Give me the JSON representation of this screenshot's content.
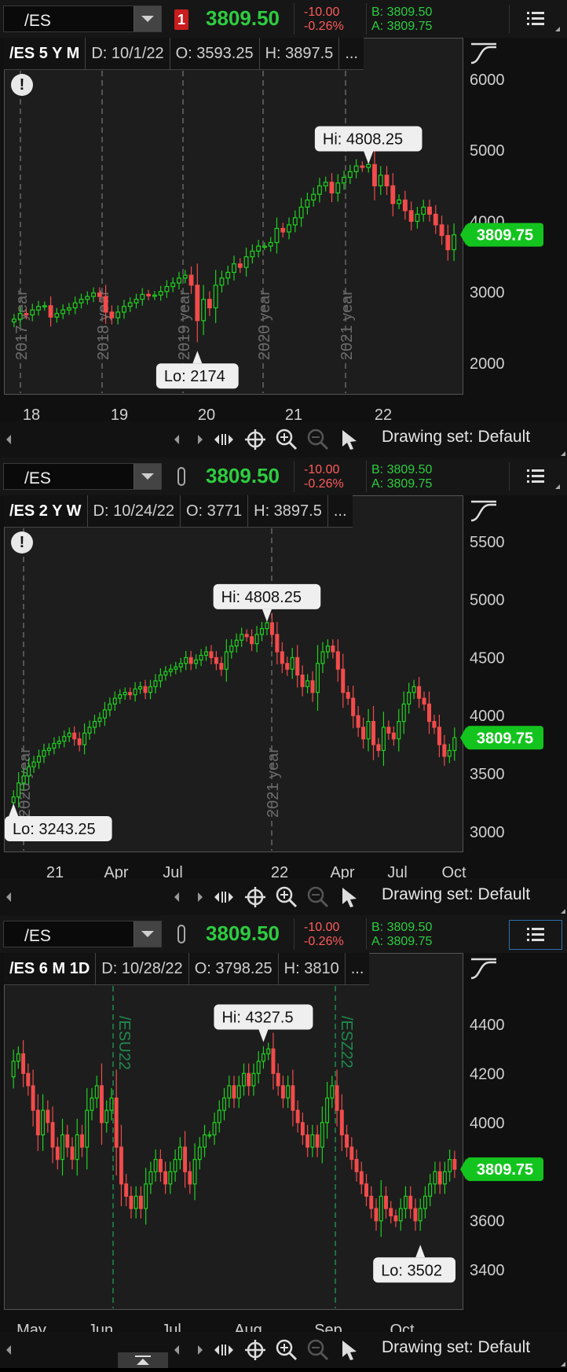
{
  "panels": [
    {
      "symbol": "/ES",
      "link": "1",
      "last": "3809.50",
      "change": "-10.00",
      "change_pct": "-0.26%",
      "bid": "B: 3809.50",
      "ask": "A: 3809.75",
      "info": [
        "/ES 5 Y M",
        "D: 10/1/22",
        "O: 3593.25",
        "H: 3897.5",
        "..."
      ],
      "price_tag": "3809.75",
      "hi": "Hi: 4808.25",
      "lo": "Lo: 2174",
      "drawing_set": "Drawing set: Default",
      "y_labels": [
        "6000",
        "5000",
        "4000",
        "3000",
        "2000"
      ],
      "x_labels": [
        "18",
        "19",
        "20",
        "21",
        "22"
      ],
      "markers": [
        "2017 year",
        "2018 year",
        "2019 year",
        "2020 year",
        "2021 year"
      ],
      "chart_data": {
        "type": "candlestick",
        "ylim": [
          1600,
          6100
        ],
        "values": [
          2620,
          2700,
          2680,
          2750,
          2800,
          2810,
          2650,
          2700,
          2750,
          2780,
          2850,
          2900,
          2940,
          2990,
          2940,
          2720,
          2640,
          2720,
          2800,
          2850,
          2900,
          2970,
          2950,
          2960,
          3010,
          3080,
          3130,
          3200,
          3240,
          3100,
          2600,
          2900,
          2780,
          3100,
          3200,
          3280,
          3400,
          3350,
          3500,
          3580,
          3650,
          3650,
          3700,
          3900,
          3850,
          3950,
          4050,
          4200,
          4300,
          4380,
          4500,
          4550,
          4400,
          4540,
          4620,
          4700,
          4780,
          4760,
          4800,
          4500,
          4650,
          4500,
          4250,
          4300,
          4150,
          4000,
          4100,
          4200,
          4100,
          3950,
          3800,
          3600,
          3810
        ],
        "hi": 4808.25,
        "lo": 2174
      }
    },
    {
      "symbol": "/ES",
      "last": "3809.50",
      "change": "-10.00",
      "change_pct": "-0.26%",
      "bid": "B: 3809.50",
      "ask": "A: 3809.75",
      "info": [
        "/ES 2 Y W",
        "D: 10/24/22",
        "O: 3771",
        "H: 3897.5",
        "..."
      ],
      "price_tag": "3809.75",
      "hi": "Hi: 4808.25",
      "lo": "Lo: 3243.25",
      "drawing_set": "Drawing set: Default",
      "y_labels": [
        "5500",
        "5000",
        "4500",
        "4000",
        "3500",
        "3000"
      ],
      "x_labels": [
        "21",
        "Apr",
        "Jul",
        "22",
        "Apr",
        "Jul",
        "Oct"
      ],
      "markers": [
        "2020 year",
        "2021 year"
      ],
      "chart_data": {
        "type": "candlestick",
        "ylim": [
          2850,
          5600
        ],
        "values": [
          3300,
          3420,
          3480,
          3560,
          3600,
          3650,
          3700,
          3720,
          3760,
          3780,
          3820,
          3850,
          3800,
          3750,
          3850,
          3900,
          3950,
          3980,
          4050,
          4100,
          4150,
          4180,
          4200,
          4180,
          4230,
          4250,
          4200,
          4250,
          4300,
          4350,
          4380,
          4400,
          4420,
          4450,
          4500,
          4450,
          4480,
          4520,
          4550,
          4500,
          4450,
          4400,
          4550,
          4600,
          4650,
          4700,
          4680,
          4620,
          4700,
          4750,
          4800,
          4700,
          4550,
          4450,
          4400,
          4500,
          4350,
          4250,
          4300,
          4200,
          4450,
          4550,
          4600,
          4550,
          4400,
          4200,
          4150,
          4000,
          3900,
          3800,
          3950,
          3750,
          3700,
          3900,
          3850,
          3800,
          3950,
          4100,
          4200,
          4250,
          4150,
          4100,
          3950,
          3900,
          3750,
          3650,
          3700,
          3810
        ],
        "hi": 4808.25,
        "lo": 3243.25
      }
    },
    {
      "symbol": "/ES",
      "last": "3809.50",
      "change": "-10.00",
      "change_pct": "-0.26%",
      "bid": "B: 3809.50",
      "ask": "A: 3809.75",
      "info": [
        "/ES 6 M 1D",
        "D: 10/28/22",
        "O: 3798.25",
        "H: 3810",
        "..."
      ],
      "price_tag": "3809.75",
      "hi": "Hi: 4327.5",
      "lo": "Lo: 3502",
      "drawing_set": "Drawing set: Default",
      "y_labels": [
        "4400",
        "4200",
        "4000",
        "3800",
        "3600",
        "3400"
      ],
      "x_labels": [
        "May",
        "Jun",
        "Jul",
        "Aug",
        "Sep",
        "Oct"
      ],
      "markers": [
        "/ESU22",
        "/ESZ22"
      ],
      "chart_data": {
        "type": "candlestick",
        "ylim": [
          3250,
          4550
        ],
        "values": [
          4250,
          4280,
          4200,
          4150,
          4050,
          3950,
          4050,
          4000,
          3900,
          3850,
          3950,
          3900,
          3850,
          3950,
          3900,
          4050,
          4100,
          4150,
          4000,
          4050,
          4100,
          3900,
          3750,
          3700,
          3650,
          3700,
          3650,
          3750,
          3800,
          3850,
          3800,
          3750,
          3800,
          3850,
          3900,
          3800,
          3750,
          3850,
          3900,
          3950,
          3950,
          4000,
          4050,
          4100,
          4150,
          4100,
          4150,
          4200,
          4150,
          4200,
          4250,
          4280,
          4300,
          4200,
          4150,
          4100,
          4150,
          4050,
          4000,
          3950,
          3900,
          3950,
          3900,
          4000,
          4100,
          4150,
          4050,
          3950,
          3900,
          3850,
          3800,
          3750,
          3700,
          3650,
          3600,
          3700,
          3650,
          3620,
          3600,
          3650,
          3700,
          3650,
          3600,
          3650,
          3700,
          3750,
          3800,
          3750,
          3800,
          3850,
          3810
        ],
        "hi": 4327.5,
        "lo": 3502
      }
    }
  ]
}
